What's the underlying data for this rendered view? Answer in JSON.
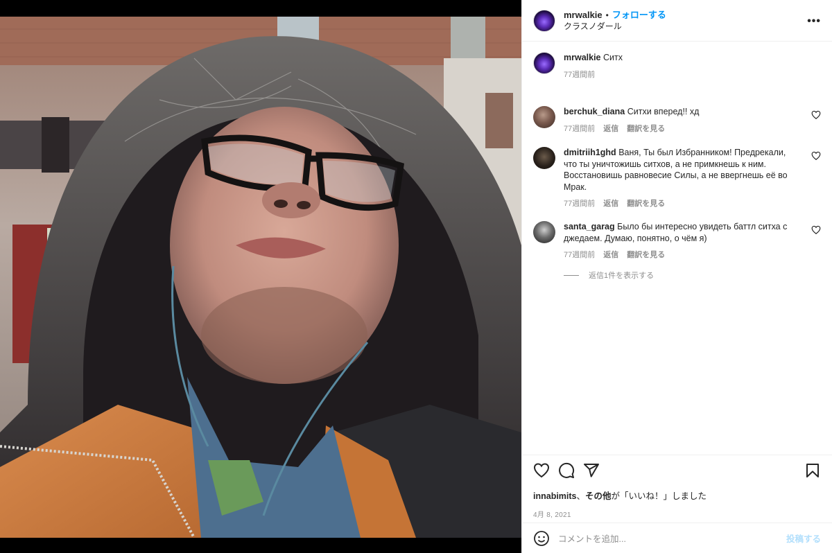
{
  "header": {
    "username": "mrwalkie",
    "separator": "•",
    "follow_label": "フォローする",
    "location": "クラスノダール",
    "more_label": "•••"
  },
  "caption": {
    "username": "mrwalkie",
    "text": "Ситх",
    "time": "77週間前"
  },
  "comments": [
    {
      "username": "berchuk_diana",
      "text": "Ситхи вперед!! хд",
      "time": "77週間前",
      "reply_label": "返信",
      "translate_label": "翻訳を見る"
    },
    {
      "username": "dmitriih1ghd",
      "text": "Ваня, Ты был Избранником! Предрекали, что ты уничтожишь ситхов, а не примкнешь к ним. Восстановишь равновесие Силы, а не ввергнешь её во Мрак.",
      "time": "77週間前",
      "reply_label": "返信",
      "translate_label": "翻訳を見る"
    },
    {
      "username": "santa_garag",
      "text": "Было бы интересно увидеть баттл ситха с джедаем. Думаю, понятно, о чём я)",
      "time": "77週間前",
      "reply_label": "返信",
      "translate_label": "翻訳を見る"
    }
  ],
  "view_replies_label": "返信1件を表示する",
  "likes": {
    "user": "innabimits",
    "connector": "、",
    "others": "その他",
    "suffix": "が「いいね！」しました"
  },
  "date": "4月 8, 2021",
  "add_comment": {
    "placeholder": "コメントを追加...",
    "post_label": "投稿する"
  },
  "icons": {
    "like": "heart-icon",
    "comment": "comment-icon",
    "share": "share-icon",
    "save": "bookmark-icon",
    "emoji": "emoji-icon",
    "comment_like": "small-heart-icon"
  }
}
